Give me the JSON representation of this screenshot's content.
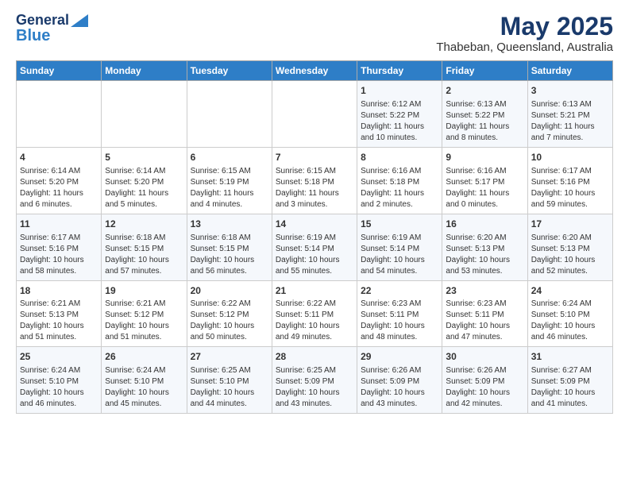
{
  "logo": {
    "line1": "General",
    "line2": "Blue"
  },
  "title": "May 2025",
  "subtitle": "Thabeban, Queensland, Australia",
  "headers": [
    "Sunday",
    "Monday",
    "Tuesday",
    "Wednesday",
    "Thursday",
    "Friday",
    "Saturday"
  ],
  "weeks": [
    [
      {
        "day": "",
        "info": ""
      },
      {
        "day": "",
        "info": ""
      },
      {
        "day": "",
        "info": ""
      },
      {
        "day": "",
        "info": ""
      },
      {
        "day": "1",
        "info": "Sunrise: 6:12 AM\nSunset: 5:22 PM\nDaylight: 11 hours\nand 10 minutes."
      },
      {
        "day": "2",
        "info": "Sunrise: 6:13 AM\nSunset: 5:22 PM\nDaylight: 11 hours\nand 8 minutes."
      },
      {
        "day": "3",
        "info": "Sunrise: 6:13 AM\nSunset: 5:21 PM\nDaylight: 11 hours\nand 7 minutes."
      }
    ],
    [
      {
        "day": "4",
        "info": "Sunrise: 6:14 AM\nSunset: 5:20 PM\nDaylight: 11 hours\nand 6 minutes."
      },
      {
        "day": "5",
        "info": "Sunrise: 6:14 AM\nSunset: 5:20 PM\nDaylight: 11 hours\nand 5 minutes."
      },
      {
        "day": "6",
        "info": "Sunrise: 6:15 AM\nSunset: 5:19 PM\nDaylight: 11 hours\nand 4 minutes."
      },
      {
        "day": "7",
        "info": "Sunrise: 6:15 AM\nSunset: 5:18 PM\nDaylight: 11 hours\nand 3 minutes."
      },
      {
        "day": "8",
        "info": "Sunrise: 6:16 AM\nSunset: 5:18 PM\nDaylight: 11 hours\nand 2 minutes."
      },
      {
        "day": "9",
        "info": "Sunrise: 6:16 AM\nSunset: 5:17 PM\nDaylight: 11 hours\nand 0 minutes."
      },
      {
        "day": "10",
        "info": "Sunrise: 6:17 AM\nSunset: 5:16 PM\nDaylight: 10 hours\nand 59 minutes."
      }
    ],
    [
      {
        "day": "11",
        "info": "Sunrise: 6:17 AM\nSunset: 5:16 PM\nDaylight: 10 hours\nand 58 minutes."
      },
      {
        "day": "12",
        "info": "Sunrise: 6:18 AM\nSunset: 5:15 PM\nDaylight: 10 hours\nand 57 minutes."
      },
      {
        "day": "13",
        "info": "Sunrise: 6:18 AM\nSunset: 5:15 PM\nDaylight: 10 hours\nand 56 minutes."
      },
      {
        "day": "14",
        "info": "Sunrise: 6:19 AM\nSunset: 5:14 PM\nDaylight: 10 hours\nand 55 minutes."
      },
      {
        "day": "15",
        "info": "Sunrise: 6:19 AM\nSunset: 5:14 PM\nDaylight: 10 hours\nand 54 minutes."
      },
      {
        "day": "16",
        "info": "Sunrise: 6:20 AM\nSunset: 5:13 PM\nDaylight: 10 hours\nand 53 minutes."
      },
      {
        "day": "17",
        "info": "Sunrise: 6:20 AM\nSunset: 5:13 PM\nDaylight: 10 hours\nand 52 minutes."
      }
    ],
    [
      {
        "day": "18",
        "info": "Sunrise: 6:21 AM\nSunset: 5:13 PM\nDaylight: 10 hours\nand 51 minutes."
      },
      {
        "day": "19",
        "info": "Sunrise: 6:21 AM\nSunset: 5:12 PM\nDaylight: 10 hours\nand 51 minutes."
      },
      {
        "day": "20",
        "info": "Sunrise: 6:22 AM\nSunset: 5:12 PM\nDaylight: 10 hours\nand 50 minutes."
      },
      {
        "day": "21",
        "info": "Sunrise: 6:22 AM\nSunset: 5:11 PM\nDaylight: 10 hours\nand 49 minutes."
      },
      {
        "day": "22",
        "info": "Sunrise: 6:23 AM\nSunset: 5:11 PM\nDaylight: 10 hours\nand 48 minutes."
      },
      {
        "day": "23",
        "info": "Sunrise: 6:23 AM\nSunset: 5:11 PM\nDaylight: 10 hours\nand 47 minutes."
      },
      {
        "day": "24",
        "info": "Sunrise: 6:24 AM\nSunset: 5:10 PM\nDaylight: 10 hours\nand 46 minutes."
      }
    ],
    [
      {
        "day": "25",
        "info": "Sunrise: 6:24 AM\nSunset: 5:10 PM\nDaylight: 10 hours\nand 46 minutes."
      },
      {
        "day": "26",
        "info": "Sunrise: 6:24 AM\nSunset: 5:10 PM\nDaylight: 10 hours\nand 45 minutes."
      },
      {
        "day": "27",
        "info": "Sunrise: 6:25 AM\nSunset: 5:10 PM\nDaylight: 10 hours\nand 44 minutes."
      },
      {
        "day": "28",
        "info": "Sunrise: 6:25 AM\nSunset: 5:09 PM\nDaylight: 10 hours\nand 43 minutes."
      },
      {
        "day": "29",
        "info": "Sunrise: 6:26 AM\nSunset: 5:09 PM\nDaylight: 10 hours\nand 43 minutes."
      },
      {
        "day": "30",
        "info": "Sunrise: 6:26 AM\nSunset: 5:09 PM\nDaylight: 10 hours\nand 42 minutes."
      },
      {
        "day": "31",
        "info": "Sunrise: 6:27 AM\nSunset: 5:09 PM\nDaylight: 10 hours\nand 41 minutes."
      }
    ]
  ]
}
